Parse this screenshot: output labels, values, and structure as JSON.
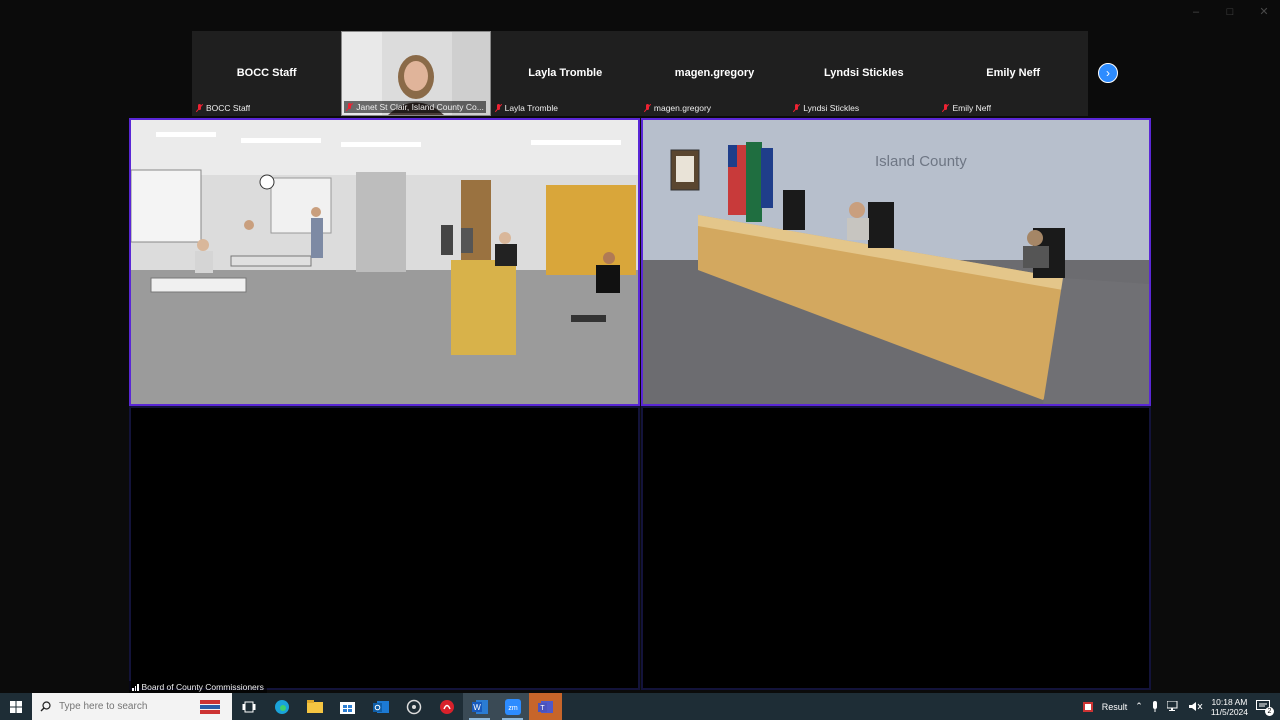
{
  "participants": [
    {
      "name": "BOCC Staff",
      "label": "BOCC Staff",
      "video": false
    },
    {
      "name": "",
      "label": "Janet St Clair, Island County Co...",
      "video": true
    },
    {
      "name": "Layla Tromble",
      "label": "Layla Tromble",
      "video": false
    },
    {
      "name": "magen.gregory",
      "label": "magen.gregory",
      "video": false
    },
    {
      "name": "Lyndsi Stickles",
      "label": "Lyndsi Stickles",
      "video": false
    },
    {
      "name": "Emily Neff",
      "label": "Emily Neff",
      "video": false
    }
  ],
  "main_video": {
    "wall_sign": "Island County"
  },
  "meeting_label": "Board of County Commissioners",
  "taskbar": {
    "search_placeholder": "Type here to search",
    "tray_result": "Result",
    "time": "10:18 AM",
    "date": "11/5/2024",
    "notification_count": "2"
  },
  "colors": {
    "active_speaker_border": "#5a27d6",
    "zoom_blue": "#2d8cff",
    "taskbar": "#1e2d36"
  }
}
